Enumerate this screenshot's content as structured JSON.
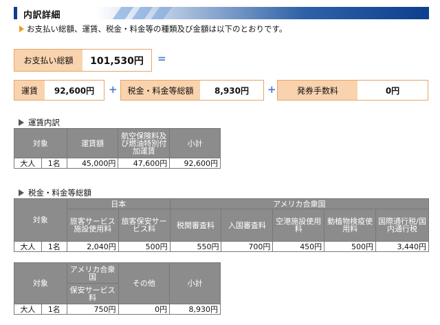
{
  "section_title": "内訳詳細",
  "intro": "お支払い総額、運賃、税金・料金等の種類及び金額は以下のとおりです。",
  "total": {
    "label": "お支払い総額",
    "value": "101,530円",
    "equals": "="
  },
  "breakdown": {
    "fare": {
      "label": "運賃",
      "value": "92,600円"
    },
    "taxes": {
      "label": "税金・料金等総額",
      "value": "8,930円"
    },
    "fee": {
      "label": "発券手数料",
      "value": "0円"
    },
    "plus": "+"
  },
  "fare_detail": {
    "title": "運賃内訳",
    "headers": [
      "対象",
      "運賃額",
      "航空保険料及び燃油特別付加運賃",
      "小計"
    ],
    "row": [
      "大人",
      "1名",
      "45,000円",
      "47,600円",
      "92,600円"
    ]
  },
  "tax_detail": {
    "title": "税金・料金等総額",
    "target": "対象",
    "country1": "日本",
    "country2": "アメリカ合衆国",
    "headers": [
      "旅客サービス施設使用料",
      "旅客保安サービス料",
      "税関審査料",
      "入国審査料",
      "空港施設使用料",
      "動植物検疫使用料",
      "国際通行税/国内通行税"
    ],
    "row": [
      "大人",
      "1名",
      "2,040円",
      "500円",
      "550円",
      "700円",
      "450円",
      "500円",
      "3,440円"
    ]
  },
  "tax_detail2": {
    "target": "対象",
    "country": "アメリカ合衆国",
    "sub_header": "保安サービス料",
    "other": "その他",
    "subtotal": "小計",
    "row": [
      "大人",
      "1名",
      "750円",
      "0円",
      "8,930円"
    ]
  },
  "colors": {
    "accent_orange": "#f29a1d",
    "label_bg": "#f9d3ae",
    "header_navy": "#0d3f8e",
    "table_header": "#8c8c8c",
    "operator_blue": "#4f7fc8"
  }
}
